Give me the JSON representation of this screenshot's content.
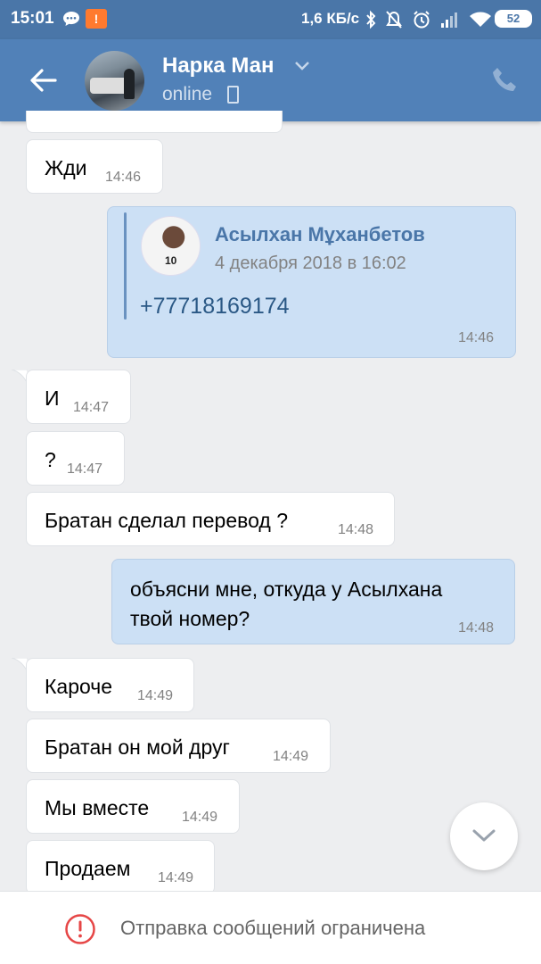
{
  "status_bar": {
    "time": "15:01",
    "app_badge": "!",
    "network_speed": "1,6 КБ/с",
    "battery": "52"
  },
  "header": {
    "name": "Нарка Ман",
    "status": "online"
  },
  "messages": [
    {
      "text": "Жди",
      "time": "14:46",
      "direction": "in"
    },
    {
      "direction": "out",
      "time": "14:46",
      "forward": {
        "sender": "Асылхан Мұханбетов",
        "date": "4 декабря 2018 в 16:02",
        "text": "+77718169174"
      }
    },
    {
      "text": "И",
      "time": "14:47",
      "direction": "in"
    },
    {
      "text": "?",
      "time": "14:47",
      "direction": "in"
    },
    {
      "text": "Братан сделал перевод ?",
      "time": "14:48",
      "direction": "in"
    },
    {
      "text_line1": "объясни мне, откуда у Асылхана",
      "text_line2": "твой номер?",
      "time": "14:48",
      "direction": "out"
    },
    {
      "text": "Кароче",
      "time": "14:49",
      "direction": "in"
    },
    {
      "text": "Братан он мой друг",
      "time": "14:49",
      "direction": "in"
    },
    {
      "text": "Мы вместе",
      "time": "14:49",
      "direction": "in"
    },
    {
      "text": "Продаем",
      "time": "14:49",
      "direction": "in"
    }
  ],
  "footer": {
    "notice": "Отправка сообщений ограничена"
  },
  "colors": {
    "header_bg": "#5181b8",
    "outgoing_bubble": "#cce0f5",
    "incoming_bubble": "#ffffff",
    "warning_red": "#e64646"
  }
}
